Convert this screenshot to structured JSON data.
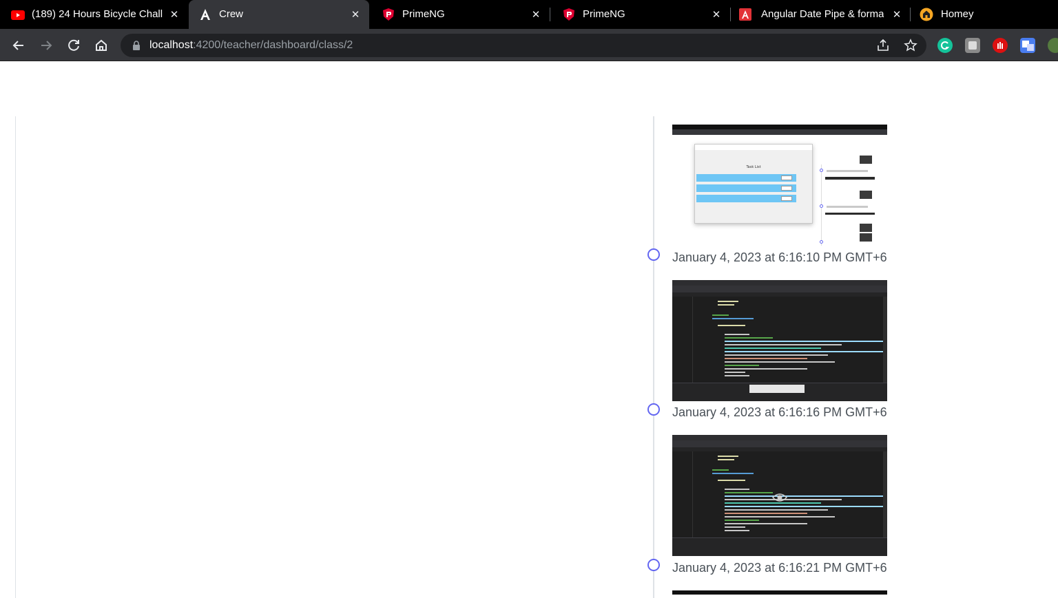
{
  "browser": {
    "tabs": [
      {
        "title": "(189) 24 Hours Bicycle Chall",
        "icon": "youtube-icon",
        "active": false
      },
      {
        "title": "Crew",
        "icon": "angular-icon",
        "active": true
      },
      {
        "title": "PrimeNG",
        "icon": "primeng-icon",
        "active": false
      },
      {
        "title": "PrimeNG",
        "icon": "primeng-icon",
        "active": false
      },
      {
        "title": "Angular Date Pipe & forma",
        "icon": "angular-docs-icon",
        "active": false
      },
      {
        "title": "Homey",
        "icon": "homey-icon",
        "active": false
      }
    ],
    "address": {
      "host": "localhost",
      "path": ":4200/teacher/dashboard/class/2"
    },
    "colors": {
      "tabstrip": "#000000",
      "toolbar": "#35363a",
      "omnibox": "#202124"
    }
  },
  "timeline": {
    "marker_color": "#6366f1",
    "events": [
      {
        "time": "January 4, 2023 at 6:16:10 PM GMT+6",
        "screenshot": "browser-task-list"
      },
      {
        "time": "January 4, 2023 at 6:16:16 PM GMT+6",
        "screenshot": "code-editor"
      },
      {
        "time": "January 4, 2023 at 6:16:21 PM GMT+6",
        "screenshot": "code-editor"
      }
    ]
  },
  "thumb_browser": {
    "window_heading": "Task List"
  }
}
